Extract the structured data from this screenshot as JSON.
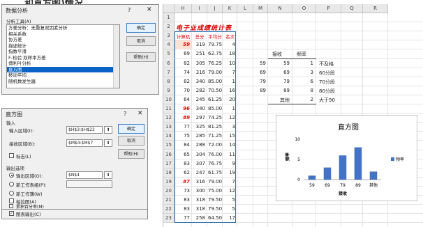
{
  "banner": "…和直方图)情况",
  "analysis_dialog": {
    "title": "数据分析",
    "help_glyph": "?",
    "close_glyph": "✕",
    "tools_label": "分析工具(A)",
    "tools": [
      "方差分析：无重复双因素分析",
      "相关系数",
      "协方差",
      "描述统计",
      "指数平滑",
      "F-检验 双样本方差",
      "傅利叶分析",
      "直方图",
      "移动平均",
      "随机数发生器"
    ],
    "selected_index": 7,
    "ok": "确定",
    "cancel": "取消",
    "help": "帮助(H)"
  },
  "histogram_dialog": {
    "title": "直方图",
    "help_glyph": "?",
    "close_glyph": "✕",
    "input_section": "输入",
    "input_range_label": "输入区域(I):",
    "input_range_value": "$H$3:$H$22",
    "bin_range_label": "接收区域(B):",
    "bin_range_value": "$M$4:$M$7",
    "labels_label": "标志(L)",
    "output_section": "输出选项",
    "out_range_label": "输出区域(O):",
    "out_range_value": "$N$4",
    "new_sheet_label": "新工作表组(P):",
    "new_book_label": "新工作簿(W)",
    "pareto_label": "柏拉图(A)",
    "cumulative_label": "累积百分率(M)",
    "chart_output_label": "图表输出(C)",
    "chart_output_check": "✓",
    "ref_glyph": "⬆",
    "ok": "确定",
    "cancel": "取消",
    "help": "帮助(H)"
  },
  "sheet": {
    "columns": [
      "H",
      "I",
      "J",
      "K",
      "L",
      "M",
      "N",
      "O",
      "P",
      "Q",
      "R"
    ],
    "rows": [
      "1",
      "2",
      "3",
      "4",
      "5",
      "6",
      "7",
      "8",
      "9",
      "10",
      "11",
      "12",
      "13",
      "14",
      "15",
      "16",
      "17",
      "18",
      "19",
      "20",
      "21",
      "22",
      "23"
    ],
    "title": "电子业成绩统计表",
    "headers": [
      "计算机",
      "总分",
      "平均分",
      "名次"
    ],
    "data": [
      [
        "59",
        "319",
        "79.75",
        "4"
      ],
      [
        "69",
        "251",
        "62.75",
        "18"
      ],
      [
        "82",
        "305",
        "76.25",
        "10"
      ],
      [
        "74",
        "316",
        "79.00",
        "7"
      ],
      [
        "82",
        "340",
        "85.00",
        "1"
      ],
      [
        "70",
        "282",
        "70.50",
        "16"
      ],
      [
        "64",
        "245",
        "61.25",
        "20"
      ],
      [
        "96",
        "340",
        "85.00",
        "1"
      ],
      [
        "89",
        "297",
        "74.25",
        "12"
      ],
      [
        "77",
        "325",
        "81.25",
        "3"
      ],
      [
        "75",
        "285",
        "71.25",
        "15"
      ],
      [
        "84",
        "288",
        "72.00",
        "14"
      ],
      [
        "65",
        "304",
        "76.00",
        "11"
      ],
      [
        "83",
        "307",
        "76.75",
        "9"
      ],
      [
        "62",
        "247",
        "61.75",
        "19"
      ],
      [
        "87",
        "316",
        "79.00",
        "7"
      ],
      [
        "73",
        "300",
        "75.00",
        "12"
      ],
      [
        "83",
        "318",
        "79.50",
        "5"
      ],
      [
        "83",
        "318",
        "79.50",
        "5"
      ],
      [
        "77",
        "258",
        "64.50",
        "17"
      ]
    ],
    "red_rows": [
      0,
      7,
      8,
      15
    ],
    "bins": [
      "59",
      "69",
      "79",
      "89"
    ],
    "freq_header_bin": "接收",
    "freq_header_freq": "频率",
    "freq_table": [
      [
        "59",
        "1"
      ],
      [
        "69",
        "3"
      ],
      [
        "79",
        "6"
      ],
      [
        "89",
        "8"
      ],
      [
        "其他",
        "2"
      ]
    ],
    "labels": [
      "不及格",
      "60分段",
      "70分段",
      "80分段",
      "大于90"
    ]
  },
  "chart_data": {
    "type": "bar",
    "title": "直方图",
    "categories": [
      "59",
      "69",
      "79",
      "89",
      "其他"
    ],
    "series": [
      {
        "name": "频率",
        "values": [
          1,
          3,
          6,
          8,
          2
        ]
      }
    ],
    "xlabel": "接收",
    "ylabel": "频率",
    "ylim": [
      0,
      10
    ],
    "yticks": [
      "0",
      "5",
      "10"
    ],
    "legend": "right",
    "colors": {
      "bar": "#4472c4"
    }
  }
}
